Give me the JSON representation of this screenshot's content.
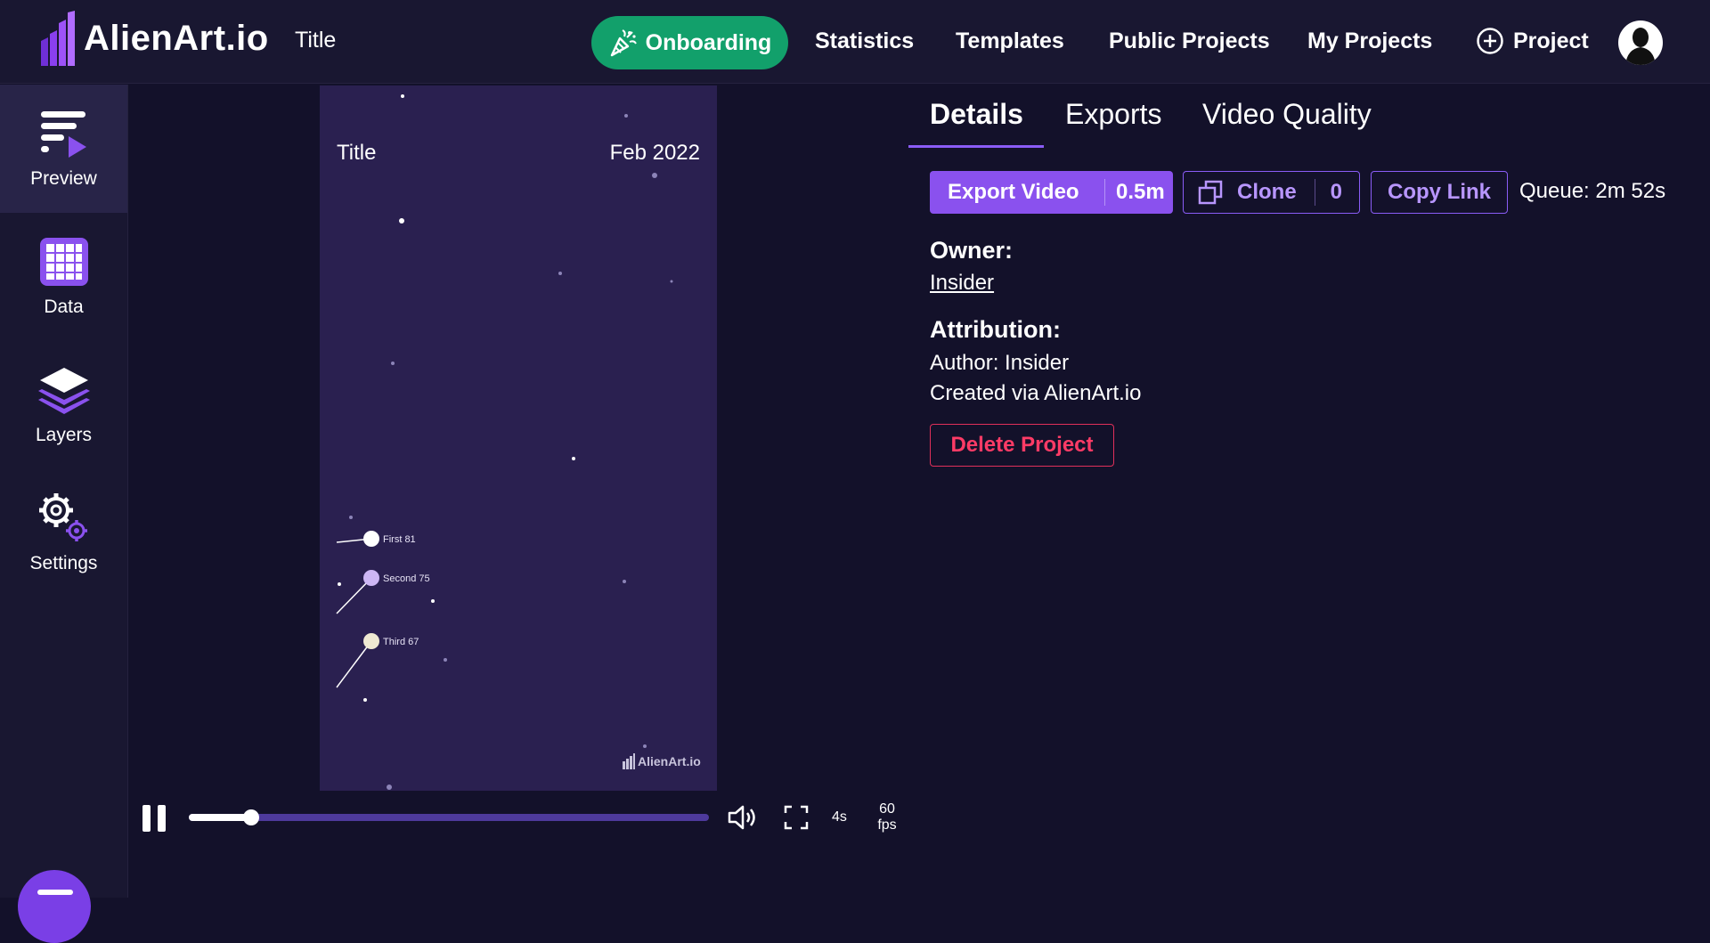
{
  "app": {
    "name": "AlienArt.io",
    "project_title": "Title"
  },
  "nav": {
    "onboarding": "Onboarding",
    "statistics": "Statistics",
    "templates": "Templates",
    "public_projects": "Public Projects",
    "my_projects": "My Projects",
    "new_project": "Project"
  },
  "sidebar": {
    "items": [
      {
        "label": "Preview",
        "icon": "preview-icon",
        "active": true
      },
      {
        "label": "Data",
        "icon": "grid-icon",
        "active": false
      },
      {
        "label": "Layers",
        "icon": "layers-icon",
        "active": false
      },
      {
        "label": "Settings",
        "icon": "gear-icon",
        "active": false
      }
    ]
  },
  "preview": {
    "title": "Title",
    "date": "Feb 2022",
    "watermark": "AlienArt.io",
    "items": [
      {
        "label": "First 81",
        "color": "#ffffff"
      },
      {
        "label": "Second 75",
        "color": "#cdb6f4"
      },
      {
        "label": "Third 67",
        "color": "#efe9d2"
      }
    ]
  },
  "player": {
    "progress": 0.12,
    "duration": "4s",
    "fps_value": "60",
    "fps_unit": "fps"
  },
  "tabs": [
    "Details",
    "Exports",
    "Video Quality"
  ],
  "actions": {
    "export_label": "Export Video",
    "export_value": "0.5m",
    "clone_label": "Clone",
    "clone_count": "0",
    "copy_link_label": "Copy Link",
    "queue": "Queue: 2m 52s"
  },
  "details": {
    "owner_heading": "Owner:",
    "owner_name": "Insider",
    "attribution_heading": "Attribution:",
    "author_line": "Author: Insider",
    "created_line": "Created via AlienArt.io",
    "delete_label": "Delete Project"
  },
  "colors": {
    "brand_purple": "#8a51ee",
    "onboarding_green": "#12a06b",
    "delete_red": "#ff3b66",
    "background": "#13112a"
  }
}
